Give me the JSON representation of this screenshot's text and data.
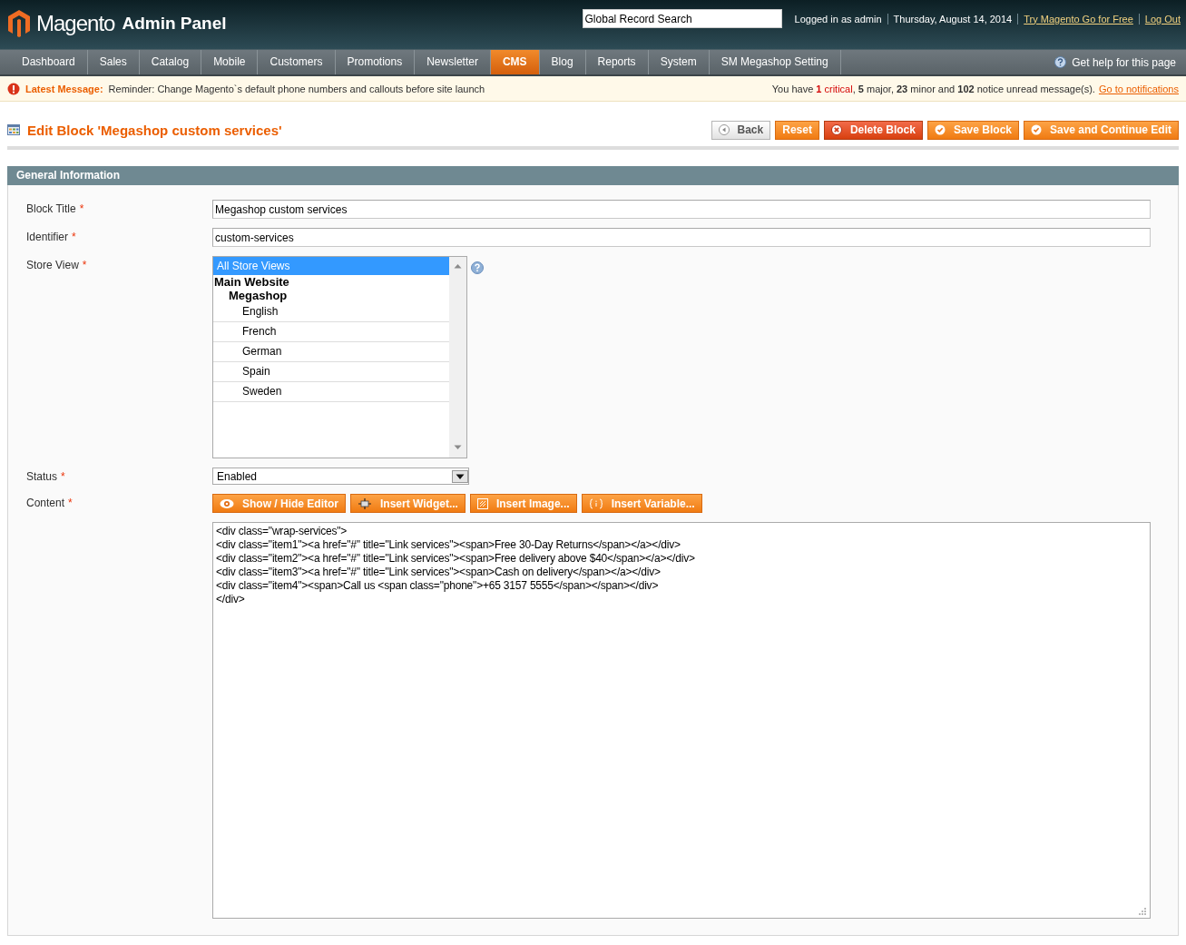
{
  "header": {
    "logo_word": "Magento",
    "logo_suffix": "Admin Panel",
    "search": {
      "placeholder": "Global Record Search"
    },
    "user_links": [
      {
        "text": "Logged in as admin",
        "kind": "text"
      },
      {
        "text": "Thursday, August 14, 2014",
        "kind": "text"
      },
      {
        "text": "Try Magento Go for Free",
        "kind": "link"
      },
      {
        "text": "Log Out",
        "kind": "link"
      }
    ]
  },
  "nav": {
    "items": [
      {
        "label": "Dashboard",
        "selected": false
      },
      {
        "label": "Sales",
        "selected": false
      },
      {
        "label": "Catalog",
        "selected": false
      },
      {
        "label": "Mobile",
        "selected": false
      },
      {
        "label": "Customers",
        "selected": false
      },
      {
        "label": "Promotions",
        "selected": false
      },
      {
        "label": "Newsletter",
        "selected": false
      },
      {
        "label": "CMS",
        "selected": true
      },
      {
        "label": "Blog",
        "selected": false
      },
      {
        "label": "Reports",
        "selected": false
      },
      {
        "label": "System",
        "selected": false
      },
      {
        "label": "SM Megashop Setting",
        "selected": false
      }
    ],
    "help": "Get help for this page"
  },
  "message_bar": {
    "label": "Latest Message:",
    "text": "Reminder: Change Magento`s default phone numbers and callouts before site launch",
    "notice": [
      {
        "text": "You have ",
        "kind": "plain"
      },
      {
        "text": "**1** critical",
        "kind": "critical"
      },
      {
        "text": ", **5** major, **23** minor and **102** notice unread message(s).",
        "kind": "plain"
      }
    ],
    "link": "Go to notifications"
  },
  "page": {
    "title": "Edit Block 'Megashop custom services'",
    "buttons": [
      {
        "label": "Back",
        "kind": "back"
      },
      {
        "label": "Reset",
        "kind": "plain"
      },
      {
        "label": "Delete Block",
        "kind": "delete"
      },
      {
        "label": "Save Block",
        "kind": "save"
      },
      {
        "label": "Save and Continue Edit",
        "kind": "save"
      }
    ]
  },
  "section": {
    "title": "General Information",
    "fields": [
      {
        "label": "Block Title",
        "required_mark": "*",
        "kind": "text",
        "value": "Megashop custom services"
      },
      {
        "label": "Identifier",
        "required_mark": "*",
        "kind": "text",
        "value": "custom-services"
      },
      {
        "label": "Store View",
        "required_mark": "*",
        "kind": "multiselect",
        "options": [
          {
            "label": "All Store Views",
            "kind": "option",
            "selected": true
          },
          {
            "label": "Main Website",
            "kind": "group",
            "children": [
              {
                "label": "Megashop",
                "kind": "group",
                "children": [
                  {
                    "label": "English",
                    "kind": "option",
                    "selected": false
                  },
                  {
                    "label": "French",
                    "kind": "option",
                    "selected": false
                  },
                  {
                    "label": "German",
                    "kind": "option",
                    "selected": false
                  },
                  {
                    "label": "Spain",
                    "kind": "option",
                    "selected": false
                  },
                  {
                    "label": "Sweden",
                    "kind": "option",
                    "selected": false
                  }
                ]
              }
            ]
          }
        ]
      },
      {
        "label": "Status",
        "required_mark": "*",
        "kind": "select",
        "value": "Enabled"
      },
      {
        "label": "Content",
        "required_mark": "*",
        "kind": "editor",
        "buttons": [
          {
            "label": "Show / Hide Editor",
            "kind": "eye"
          },
          {
            "label": "Insert Widget...",
            "kind": "widget"
          },
          {
            "label": "Insert Image...",
            "kind": "image"
          },
          {
            "label": "Insert Variable...",
            "kind": "variable"
          }
        ],
        "lines": [
          "<div class=\"wrap-services\">",
          "<div class=\"item1\"><a href=\"#\" title=\"Link services\"><span>Free 30-Day Returns</span></a></div>",
          "<div class=\"item2\"><a href=\"#\" title=\"Link services\"><span>Free delivery above $40</span></a></div>",
          "<div class=\"item3\"><a href=\"#\" title=\"Link services\"><span>Cash on delivery</span></a></div>",
          "<div class=\"item4\"><span>Call us <span class=\"phone\">+65 3157 5555</span></span></div>",
          "</div>"
        ]
      }
    ]
  }
}
